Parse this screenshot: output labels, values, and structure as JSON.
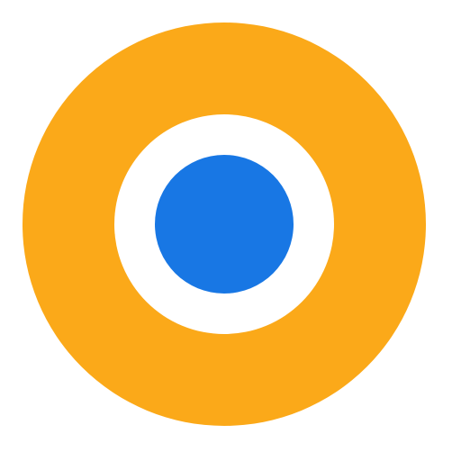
{
  "icon": {
    "name": "target-ring-icon",
    "colors": {
      "outer_ring": "#FBA919",
      "inner_ring": "#FFFFFF",
      "center_dot": "#1877E4",
      "background": "#FFFFFF"
    }
  }
}
